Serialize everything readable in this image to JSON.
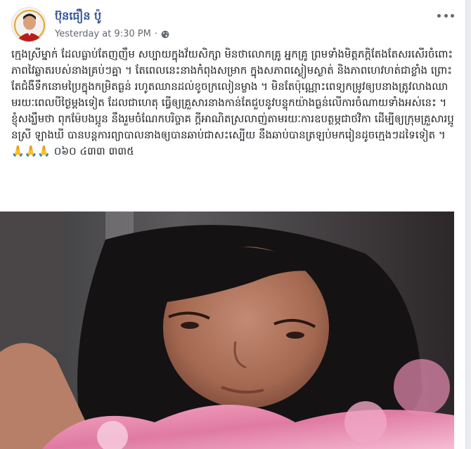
{
  "post": {
    "author": "ប៊ុនធឿន ប៉ូ",
    "timestamp": "Yesterday at 9:30 PM",
    "separator": "·",
    "privacy_icon": "globe-icon",
    "more_icon": "more-options-icon",
    "text": "ក្មេងស្រីម្នាក់ ដែលធ្លាប់តែញញឹម សប្បាយក្នុងវ័យសិក្សា មិនថាលោកគ្រូ អ្នកគ្រូ ព្រមទាំងមិត្តភក្តិតែងតែសរសើរចំពោះភាពវៃឆ្លាតរបស់នាងគ្រប់ៗគ្នា ។ តែពេលនេះនាងកំពុងសម្រាក ក្នុងសភាពស្ងៀមស្ងាត់ និងភាពហេវហត់ជាខ្លាំង ព្រោះតែជំងឺទឹកនោមប្រៃក្នុងកម្រិតធ្ងន់ រហូតឈានដល់ខូចក្រលៀនម្ខាង ។ មិនតែប៉ុណ្ណោះពេទ្យកម្រូវឲ្យបនាងត្រូវលាងឈាមរយៈពេលបីថ្ងៃម្តងទៀត ដែលជាហេតុ ធ្វើឲ្យគ្រួសារនាងកាន់តែជួបនូវបន្ទុកយ៉ាងធ្ងន់លើការចំណាយទាំងអស់នេះ ។ ខ្ញុំសង្ឃឹមថា ពុកម៉ែបងប្អូន នឹងរួមចំណែកបរិច្ចាគ ក្តីអាណិតស្រលាញ់តាមរយៈការឧបត្ថម្ភជាថវិកា ដើម្បីឲ្យក្រុមគ្រួសារប្អូនស្រី ឡាងឃី បានបន្តការព្យាបាលនាងឲ្យបានឆាប់ជាសះស្បើយ នឹងឆាប់បានត្រឡប់មករៀនដូចក្មេងៗដទៃទៀត ។🙏🙏🙏 ០៦០ ៤៣៣ ៣៣៥"
  },
  "colors": {
    "author_link": "#365899",
    "meta_text": "#616770",
    "body_text": "#1c1e21",
    "page_bg": "#e9ebee",
    "card_bg": "#ffffff"
  }
}
